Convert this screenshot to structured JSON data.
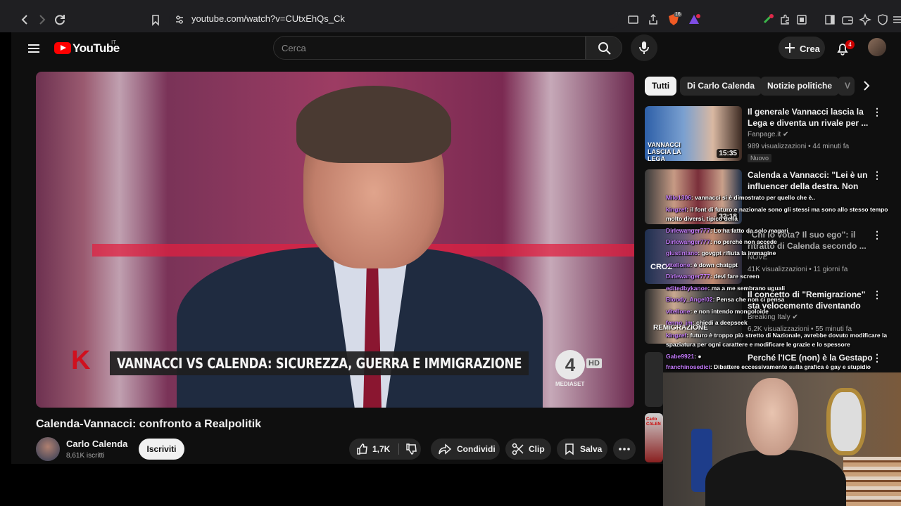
{
  "browser": {
    "url": "youtube.com/watch?v=CUtxEhQs_Ck",
    "ext_badge": "16"
  },
  "header": {
    "logo": "YouTube",
    "country": "IT",
    "search_placeholder": "Cerca",
    "create_label": "Crea",
    "notifications_count": "4"
  },
  "video": {
    "caption": "VANNACCI VS CALENDA: SICUREZZA, GUERRA E IMMIGRAZIONE",
    "caption_prefix": "K",
    "network_logo": "4",
    "network_hd": "HD",
    "network_label": "MEDIASET",
    "title": "Calenda-Vannacci: confronto a Realpolitik",
    "channel": "Carlo Calenda",
    "subscribers": "8,61K iscritti",
    "subscribe_label": "Iscriviti",
    "likes": "1,7K",
    "share_label": "Condividi",
    "clip_label": "Clip",
    "save_label": "Salva"
  },
  "chips": [
    "Tutti",
    "Di Carlo Calenda",
    "Notizie politiche",
    "V"
  ],
  "recommendations": [
    {
      "title": "Il generale Vannacci lascia la Lega e diventa un rivale per ...",
      "channel": "Fanpage.it",
      "meta": "989 visualizzazioni • 44 minuti fa",
      "badge": "Nuovo",
      "duration": "15:35",
      "thumb_text": "VANNACCI LASCIA LA LEGA"
    },
    {
      "title": "Calenda a Vannacci: \"Lei è un influencer della destra. Non di...",
      "channel": "",
      "meta": "",
      "badge": "",
      "duration": "32:18",
      "thumb_text": ""
    },
    {
      "title": "\"Chi lo vota? Il suo ego\": il ritratto di Calenda secondo ...",
      "channel": "NOVE",
      "meta": "41K visualizzazioni • 11 giorni fa",
      "badge": "",
      "duration": "",
      "thumb_text": "CROZ"
    },
    {
      "title": "Il concetto di \"Remigrazione\" sta velocemente diventando di...",
      "channel": "Breaking Italy",
      "meta": "6,2K visualizzazioni • 55 minuti fa",
      "badge": "",
      "duration": "",
      "thumb_text": "REMIGRAZIONE"
    },
    {
      "title": "Perché l'ICE (non) è la Gestapo",
      "channel": "",
      "meta": "",
      "badge": "",
      "duration": "",
      "thumb_text": ""
    },
    {
      "title": "",
      "channel": "",
      "meta": "",
      "badge": "",
      "duration": "",
      "thumb_text": "Carlo CALEN"
    }
  ],
  "chat": [
    {
      "user": "Milo1306",
      "text": ": vannacci si è dimostrato per quello che è.."
    },
    {
      "user": "kingzef",
      "text": ": il font di futuro e nazionale sono gli stessi ma sono allo stesso tempo"
    },
    {
      "user": "",
      "text": "molto diversi, tipico della"
    },
    {
      "user": "Dirlewanger777",
      "text": ": Lo ha fatto da solo magari"
    },
    {
      "user": "Dirlewanger777",
      "text": ": no perché non accede"
    },
    {
      "user": "giustiniano",
      "text": ": govgpt rifiuta la immagine"
    },
    {
      "user": "vitellone",
      "text": ": è down chatgpt"
    },
    {
      "user": "Dirlewanger777",
      "text": ": devi fare screen"
    },
    {
      "user": "editedbykanoe",
      "text": ": ma a me sembrano uguali"
    },
    {
      "user": "Bloody_Angel02",
      "text": ": Pensa che non ci pensa"
    },
    {
      "user": "vitellone",
      "text": ": e non intendo mongoloide"
    },
    {
      "user": "fenno_jm",
      "text": ": chiedi a deepseek"
    },
    {
      "user": "kingzef",
      "text": ": futuro è troppo più stretto di Nazionale, avrebbe dovuto modificare la"
    },
    {
      "user": "",
      "text": "spaziatura per ogni carattere e modificare le grazie e lo spessore"
    },
    {
      "user": "Gabe9921",
      "text": ": ●"
    },
    {
      "user": "franchinosedici",
      "text": ": Dibattere eccessivamente sulla grafica è gay e stupidio"
    }
  ],
  "colors": {
    "yt_red": "#ff0000",
    "background": "#0f0f0f",
    "chip_bg": "#272727",
    "chat_user": "#c77dff"
  },
  "icons": {
    "back": "back-arrow-icon",
    "forward": "forward-arrow-icon",
    "reload": "reload-icon",
    "bookmark": "bookmark-icon",
    "menu": "hamburger-menu-icon",
    "search": "search-icon",
    "mic": "microphone-icon",
    "bell": "bell-icon"
  }
}
